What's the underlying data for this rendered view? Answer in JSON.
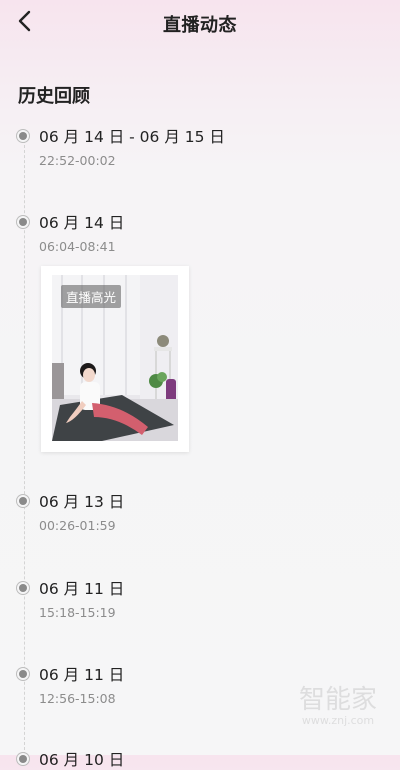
{
  "header": {
    "title": "直播动态"
  },
  "section_title": "历史回顾",
  "entries": [
    {
      "date": "06 月 14 日 - 06 月 15 日",
      "time": "22:52-00:02"
    },
    {
      "date": "06 月 14 日",
      "time": "06:04-08:41"
    },
    {
      "date": "06 月 13 日",
      "time": "00:26-01:59"
    },
    {
      "date": "06 月 11 日",
      "time": "15:18-15:19"
    },
    {
      "date": "06 月 11 日",
      "time": "12:56-15:08"
    },
    {
      "date": "06 月 10 日",
      "time": ""
    }
  ],
  "highlight": {
    "badge": "直播高光"
  },
  "watermark": {
    "logo": "智能家",
    "url": "www.znj.com"
  },
  "icons": {
    "back": "chevron-left-icon",
    "node": "timeline-dot-icon"
  },
  "colors": {
    "header_pink": "#f7e4ee",
    "text": "#222222",
    "muted": "#8c8c8c",
    "badge_bg": "#5a5a5a"
  }
}
